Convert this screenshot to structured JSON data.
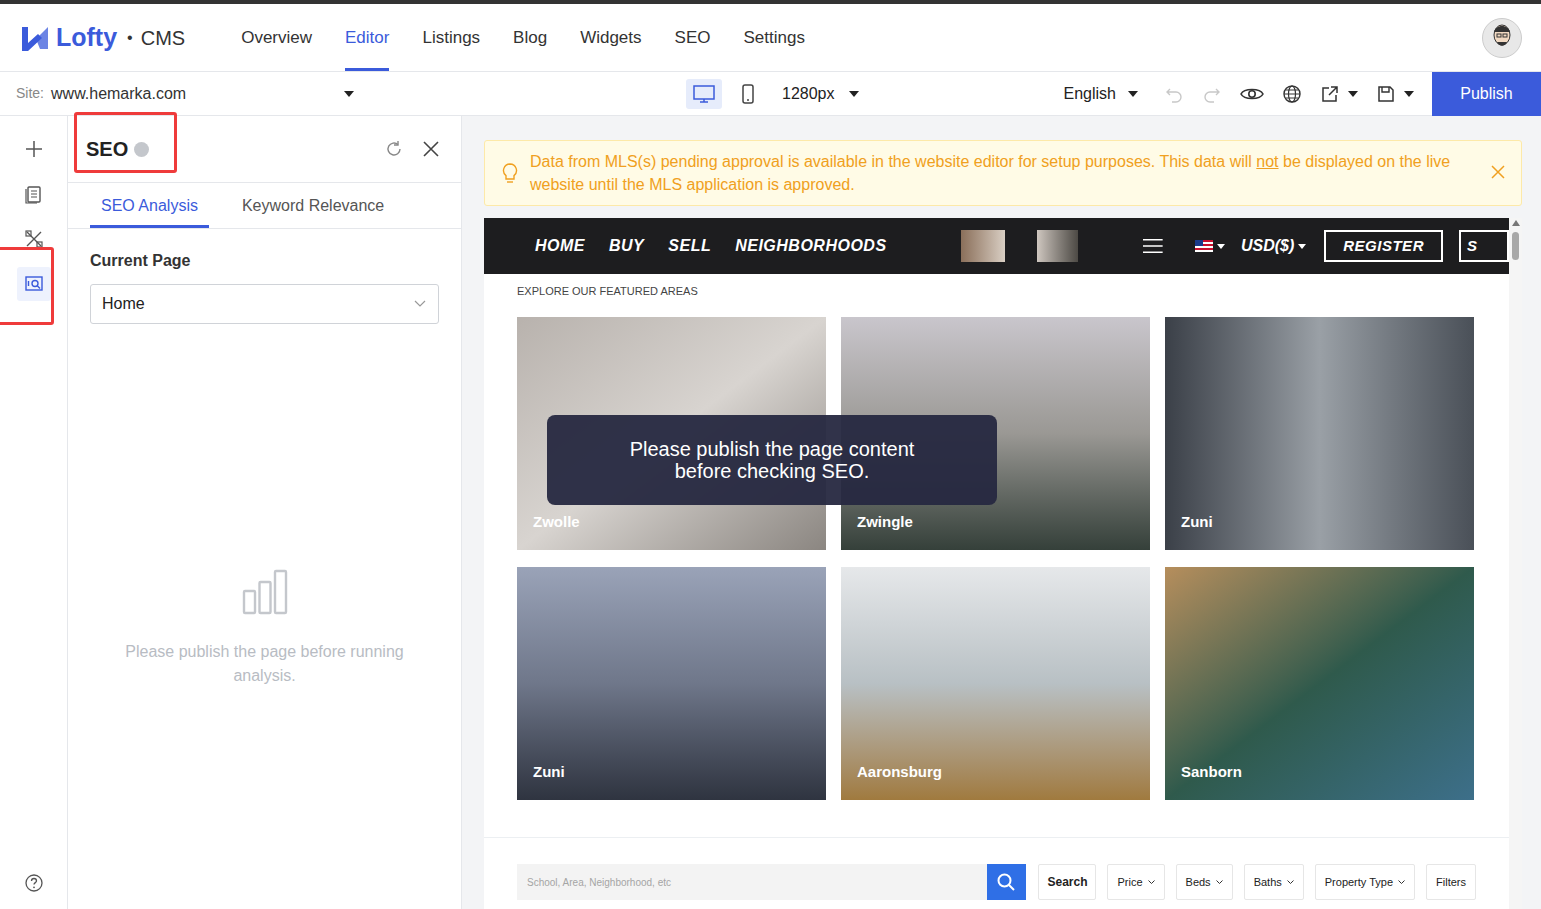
{
  "app": {
    "logo": "Lofty",
    "separator": "•",
    "product": "CMS"
  },
  "nav": [
    {
      "label": "Overview",
      "selected": false
    },
    {
      "label": "Editor",
      "selected": true
    },
    {
      "label": "Listings",
      "selected": false
    },
    {
      "label": "Blog",
      "selected": false
    },
    {
      "label": "Widgets",
      "selected": false
    },
    {
      "label": "SEO",
      "selected": false
    },
    {
      "label": "Settings",
      "selected": false
    }
  ],
  "toolbar": {
    "site_label": "Site:",
    "site": "www.hemarka.com",
    "devices": [
      {
        "kind": "desktop",
        "selected": true
      },
      {
        "kind": "mobile",
        "selected": false
      }
    ],
    "width": "1280px",
    "language": "English",
    "actions": [
      {
        "kind": "undo",
        "disabled": true,
        "has_menu": false
      },
      {
        "kind": "redo",
        "disabled": true,
        "has_menu": false
      },
      {
        "kind": "preview",
        "disabled": false,
        "has_menu": false
      },
      {
        "kind": "globe",
        "disabled": false,
        "has_menu": false
      },
      {
        "kind": "share",
        "disabled": false,
        "has_menu": true
      },
      {
        "kind": "save",
        "disabled": false,
        "has_menu": true
      }
    ],
    "publish": "Publish"
  },
  "rail": [
    {
      "kind": "add",
      "selected": false,
      "highlighted": false
    },
    {
      "kind": "pages",
      "selected": false,
      "highlighted": false
    },
    {
      "kind": "tools",
      "selected": false,
      "highlighted": false
    },
    {
      "kind": "seo",
      "selected": true,
      "highlighted": true
    }
  ],
  "panel": {
    "title": "SEO",
    "highlighted": true,
    "tabs": [
      {
        "label": "SEO Analysis",
        "selected": true
      },
      {
        "label": "Keyword Relevance",
        "selected": false
      }
    ],
    "field_label": "Current Page",
    "field_value": "Home",
    "empty_message": "Please publish the page before running analysis."
  },
  "banner": {
    "before": "Data from MLS(s) pending approval is available in the website editor for setup purposes. This data will ",
    "emphasis": "not",
    "after": " be displayed on the live website until the MLS application is approved."
  },
  "preview": {
    "menu": [
      "HOME",
      "BUY",
      "SELL",
      "NEIGHBORHOODS"
    ],
    "currency": "USD($)",
    "register": "REGISTER",
    "cut_button": "S",
    "section_title": "EXPLORE OUR FEATURED AREAS",
    "areas": [
      "Zwolle",
      "Zwingle",
      "Zuni",
      "Zuni",
      "Aaronsburg",
      "Sanborn"
    ],
    "search": {
      "placeholder": "School, Area, Neighborhood, etc",
      "button": "Search",
      "filters": [
        "Price",
        "Beds",
        "Baths",
        "Property Type"
      ],
      "more": "Filters"
    }
  },
  "toast": "Please publish the page content before checking SEO."
}
